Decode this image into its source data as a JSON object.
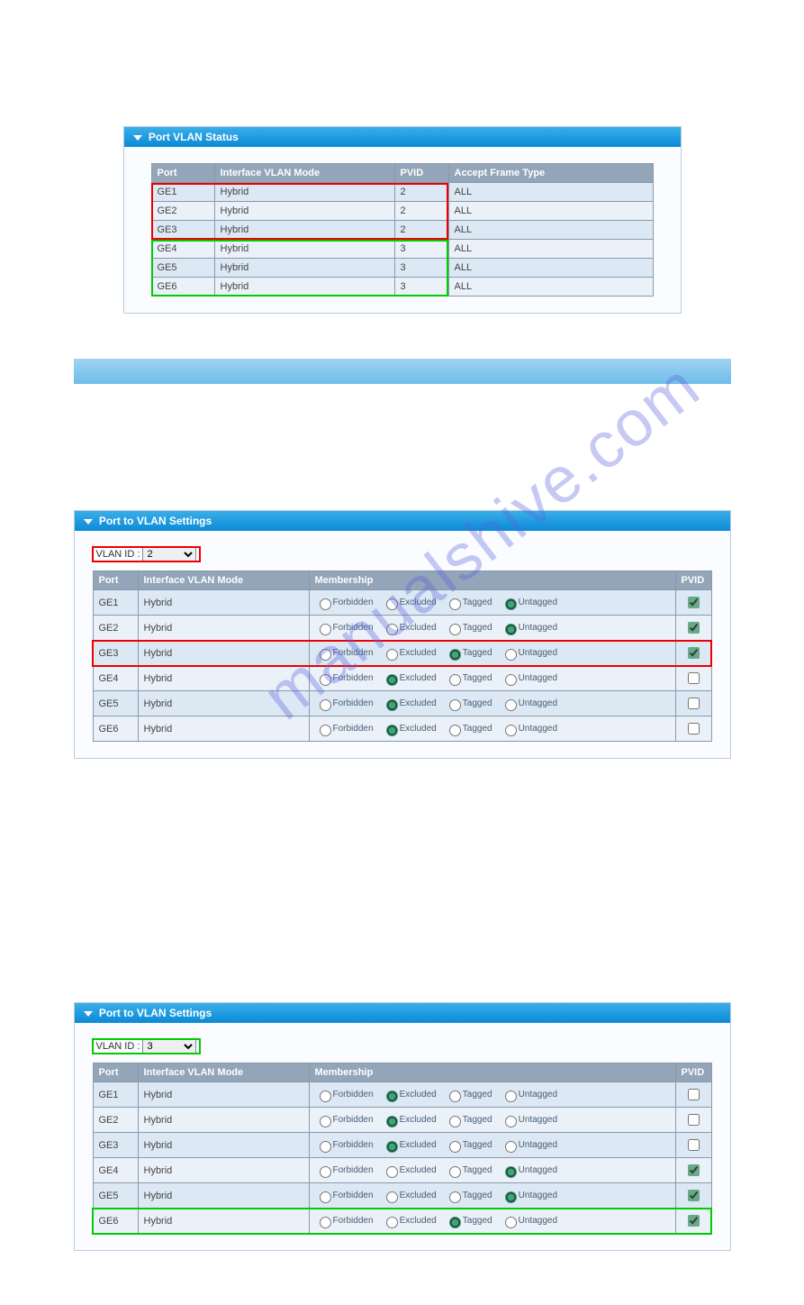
{
  "panel1": {
    "title": "Port VLAN Status",
    "cols": [
      "Port",
      "Interface VLAN Mode",
      "PVID",
      "Accept Frame Type"
    ],
    "rows": [
      {
        "port": "GE1",
        "mode": "Hybrid",
        "pvid": "2",
        "aft": "ALL"
      },
      {
        "port": "GE2",
        "mode": "Hybrid",
        "pvid": "2",
        "aft": "ALL"
      },
      {
        "port": "GE3",
        "mode": "Hybrid",
        "pvid": "2",
        "aft": "ALL"
      },
      {
        "port": "GE4",
        "mode": "Hybrid",
        "pvid": "3",
        "aft": "ALL"
      },
      {
        "port": "GE5",
        "mode": "Hybrid",
        "pvid": "3",
        "aft": "ALL"
      },
      {
        "port": "GE6",
        "mode": "Hybrid",
        "pvid": "3",
        "aft": "ALL"
      }
    ]
  },
  "panel2": {
    "title": "Port to VLAN Settings",
    "vlan_label": "VLAN ID :",
    "vlan_id": "2",
    "cols": [
      "Port",
      "Interface VLAN Mode",
      "Membership",
      "PVID"
    ],
    "radio_opts": [
      "Forbidden",
      "Excluded",
      "Tagged",
      "Untagged"
    ],
    "rows": [
      {
        "port": "GE1",
        "mode": "Hybrid",
        "sel": "Untagged",
        "pvid": true
      },
      {
        "port": "GE2",
        "mode": "Hybrid",
        "sel": "Untagged",
        "pvid": true
      },
      {
        "port": "GE3",
        "mode": "Hybrid",
        "sel": "Tagged",
        "pvid": true,
        "hl": "red"
      },
      {
        "port": "GE4",
        "mode": "Hybrid",
        "sel": "Excluded",
        "pvid": false
      },
      {
        "port": "GE5",
        "mode": "Hybrid",
        "sel": "Excluded",
        "pvid": false
      },
      {
        "port": "GE6",
        "mode": "Hybrid",
        "sel": "Excluded",
        "pvid": false
      }
    ],
    "vlan_box_hl": "red"
  },
  "panel3": {
    "title": "Port to VLAN Settings",
    "vlan_label": "VLAN ID :",
    "vlan_id": "3",
    "cols": [
      "Port",
      "Interface VLAN Mode",
      "Membership",
      "PVID"
    ],
    "radio_opts": [
      "Forbidden",
      "Excluded",
      "Tagged",
      "Untagged"
    ],
    "rows": [
      {
        "port": "GE1",
        "mode": "Hybrid",
        "sel": "Excluded",
        "pvid": false
      },
      {
        "port": "GE2",
        "mode": "Hybrid",
        "sel": "Excluded",
        "pvid": false
      },
      {
        "port": "GE3",
        "mode": "Hybrid",
        "sel": "Excluded",
        "pvid": false
      },
      {
        "port": "GE4",
        "mode": "Hybrid",
        "sel": "Untagged",
        "pvid": true
      },
      {
        "port": "GE5",
        "mode": "Hybrid",
        "sel": "Untagged",
        "pvid": true
      },
      {
        "port": "GE6",
        "mode": "Hybrid",
        "sel": "Tagged",
        "pvid": true,
        "hl": "green"
      }
    ],
    "vlan_box_hl": "green"
  }
}
